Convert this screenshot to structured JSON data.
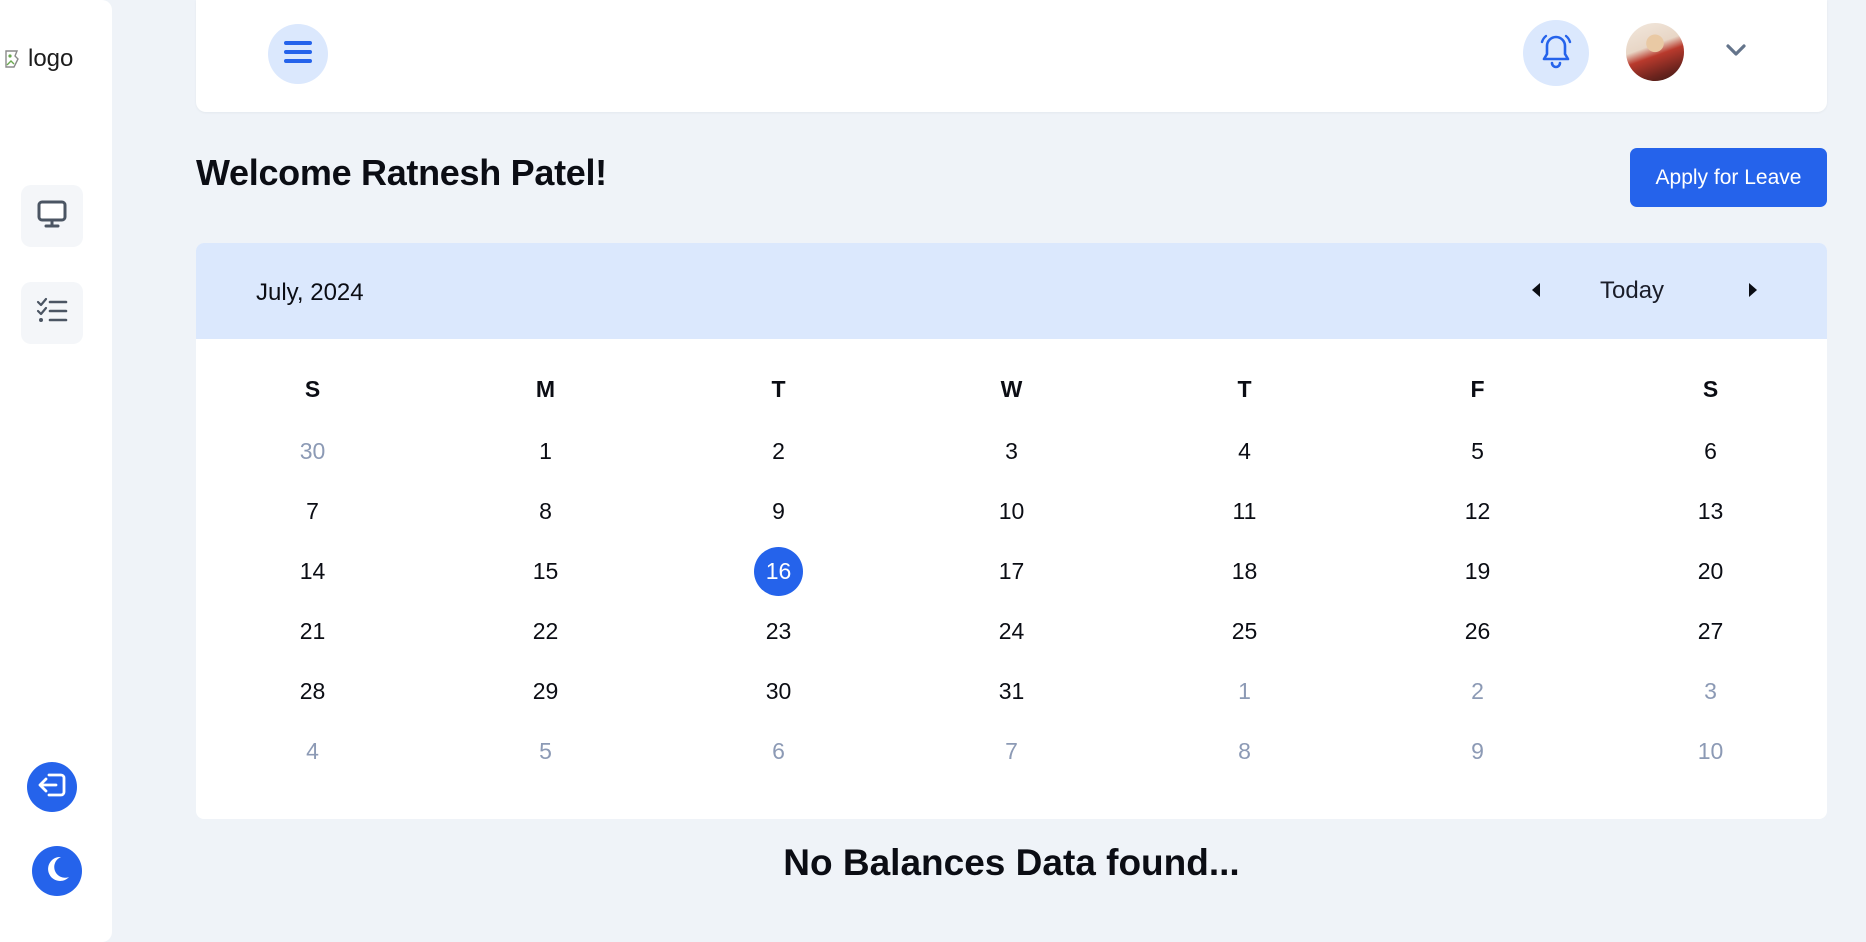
{
  "sidebar": {
    "logo_alt": "logo",
    "icons": {
      "monitor": "monitor-icon",
      "tasks": "checklist-icon",
      "logout": "logout-icon",
      "theme": "moon-icon"
    }
  },
  "topbar": {
    "icons": {
      "menu": "hamburger-icon",
      "notifications": "bell-icon",
      "profile_menu": "chevron-down-icon"
    }
  },
  "welcome": {
    "title": "Welcome Ratnesh Patel!",
    "apply_button": "Apply for Leave"
  },
  "calendar": {
    "title": "July, 2024",
    "today_label": "Today",
    "weekdays": [
      "S",
      "M",
      "T",
      "W",
      "T",
      "F",
      "S"
    ],
    "weeks": [
      [
        {
          "d": "30",
          "muted": true
        },
        {
          "d": "1"
        },
        {
          "d": "2"
        },
        {
          "d": "3"
        },
        {
          "d": "4"
        },
        {
          "d": "5"
        },
        {
          "d": "6"
        }
      ],
      [
        {
          "d": "7"
        },
        {
          "d": "8"
        },
        {
          "d": "9"
        },
        {
          "d": "10"
        },
        {
          "d": "11"
        },
        {
          "d": "12"
        },
        {
          "d": "13"
        }
      ],
      [
        {
          "d": "14"
        },
        {
          "d": "15"
        },
        {
          "d": "16",
          "today": true
        },
        {
          "d": "17"
        },
        {
          "d": "18"
        },
        {
          "d": "19"
        },
        {
          "d": "20"
        }
      ],
      [
        {
          "d": "21"
        },
        {
          "d": "22"
        },
        {
          "d": "23"
        },
        {
          "d": "24"
        },
        {
          "d": "25"
        },
        {
          "d": "26"
        },
        {
          "d": "27"
        }
      ],
      [
        {
          "d": "28"
        },
        {
          "d": "29"
        },
        {
          "d": "30"
        },
        {
          "d": "31"
        },
        {
          "d": "1",
          "muted": true
        },
        {
          "d": "2",
          "muted": true
        },
        {
          "d": "3",
          "muted": true
        }
      ],
      [
        {
          "d": "4",
          "muted": true
        },
        {
          "d": "5",
          "muted": true
        },
        {
          "d": "6",
          "muted": true
        },
        {
          "d": "7",
          "muted": true
        },
        {
          "d": "8",
          "muted": true
        },
        {
          "d": "9",
          "muted": true
        },
        {
          "d": "10",
          "muted": true
        }
      ]
    ]
  },
  "balances": {
    "empty_message": "No Balances Data found..."
  },
  "colors": {
    "accent": "#2563eb",
    "accent_light": "#dbe8fd",
    "background": "#eff3f8",
    "muted_day": "#8c9ab5"
  }
}
